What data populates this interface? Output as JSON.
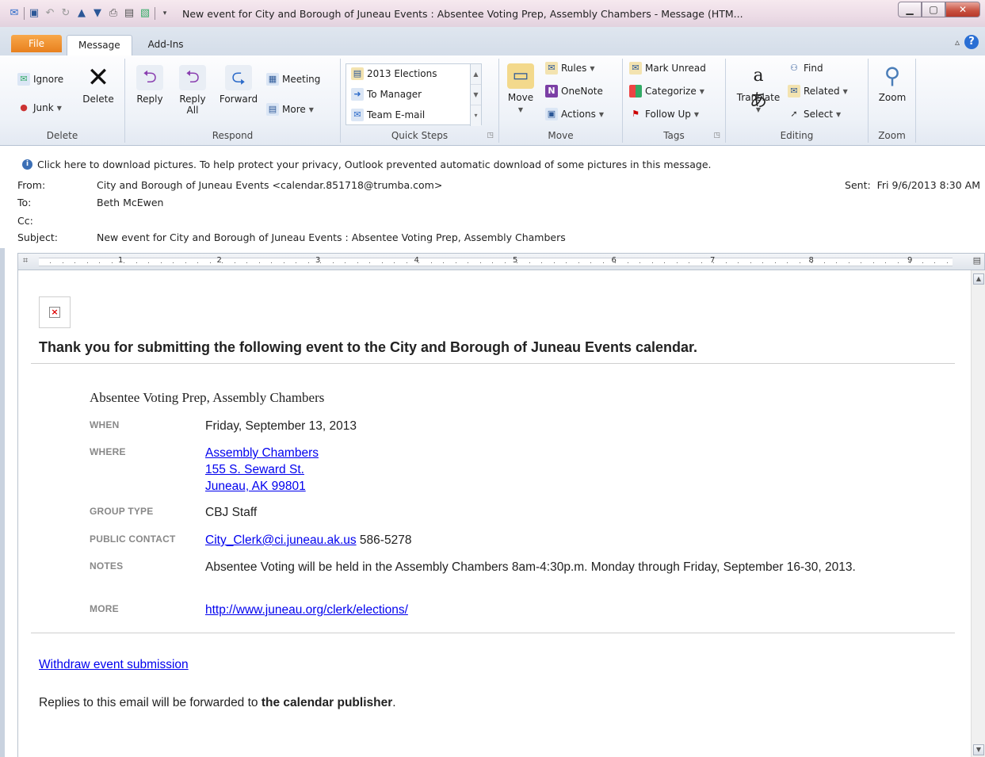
{
  "window": {
    "title": "New event for City and Borough of Juneau Events : Absentee Voting Prep, Assembly Chambers  -  Message (HTM..."
  },
  "ribbon_tabs": [
    "File",
    "Message",
    "Add-Ins"
  ],
  "ribbon": {
    "delete_group": {
      "ignore": "Ignore",
      "junk": "Junk",
      "delete": "Delete",
      "label": "Delete"
    },
    "respond_group": {
      "reply": "Reply",
      "reply_all_1": "Reply",
      "reply_all_2": "All",
      "forward": "Forward",
      "meeting": "Meeting",
      "more": "More",
      "label": "Respond"
    },
    "quick_steps": {
      "items": [
        "2013 Elections",
        "To Manager",
        "Team E-mail"
      ],
      "label": "Quick Steps"
    },
    "move_group": {
      "move": "Move",
      "rules": "Rules",
      "onenote": "OneNote",
      "actions": "Actions",
      "label": "Move"
    },
    "tags_group": {
      "mark_unread": "Mark Unread",
      "categorize": "Categorize",
      "follow_up": "Follow Up",
      "label": "Tags"
    },
    "editing_group": {
      "translate": "Translate",
      "find": "Find",
      "related": "Related",
      "select": "Select",
      "label": "Editing"
    },
    "zoom_group": {
      "zoom": "Zoom",
      "label": "Zoom"
    }
  },
  "header": {
    "infobar": "Click here to download pictures. To help protect your privacy, Outlook prevented automatic download of some pictures in this message.",
    "from_label": "From:",
    "from_value": "City and Borough of Juneau Events <calendar.851718@trumba.com>",
    "to_label": "To:",
    "to_value": "Beth McEwen",
    "cc_label": "Cc:",
    "cc_value": "",
    "subject_label": "Subject:",
    "subject_value": "New event for City and Borough of Juneau Events : Absentee Voting Prep, Assembly Chambers",
    "sent_label": "Sent:",
    "sent_value": "Fri 9/6/2013 8:30 AM"
  },
  "ruler": {
    "numbers": [
      "1",
      "2",
      "3",
      "4",
      "5",
      "6",
      "7",
      "8",
      "9"
    ]
  },
  "message": {
    "title": "Thank you for submitting the following event to the City and Borough of Juneau Events calendar.",
    "event_title": "Absentee Voting Prep, Assembly Chambers",
    "when_label": "WHEN",
    "when_value": "Friday, September 13, 2013",
    "where_label": "WHERE",
    "where_line1": "Assembly Chambers",
    "where_line2": "155 S. Seward St.",
    "where_line3": "Juneau, AK 99801",
    "group_label": "GROUP TYPE",
    "group_value": "CBJ Staff",
    "contact_label": "PUBLIC CONTACT",
    "contact_email": "City_Clerk@ci.juneau.ak.us",
    "contact_phone": " 586-5278",
    "notes_label": "NOTES",
    "notes_value": "Absentee Voting will be held in the Assembly Chambers 8am-4:30p.m. Monday through Friday, September 16-30, 2013.",
    "more_label": "MORE",
    "more_value": "http://www.juneau.org/clerk/elections/",
    "withdraw": "Withdraw event submission",
    "replies_pre": "Replies to this email will be forwarded to ",
    "replies_bold": "the calendar publisher",
    "replies_post": "."
  },
  "colors": {
    "accent": "#2b5797",
    "file_tab": "#e8801e",
    "link": "#0000ee",
    "label_gray": "#888888"
  }
}
